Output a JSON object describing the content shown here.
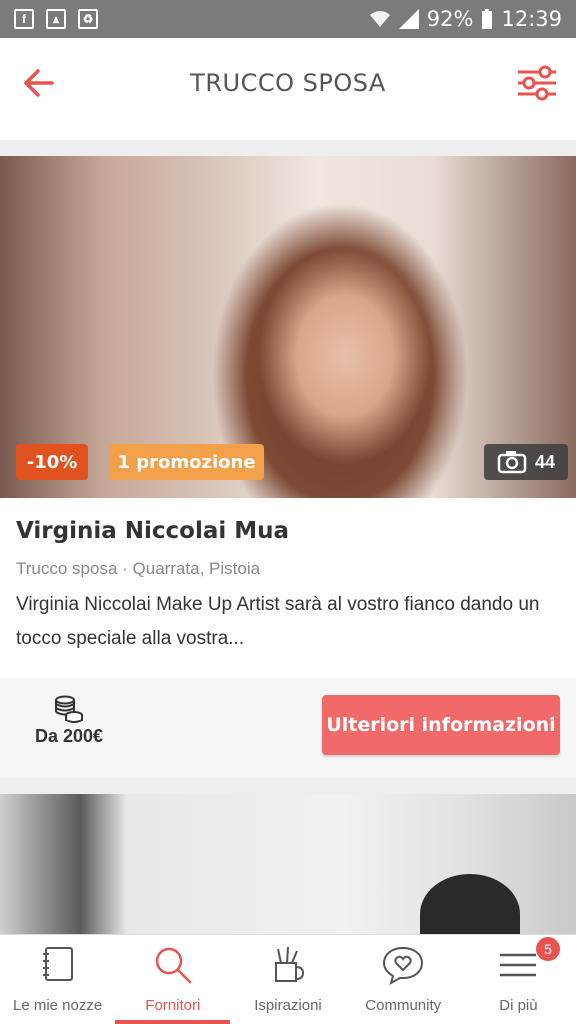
{
  "status_bar": {
    "battery": "92%",
    "time": "12:39"
  },
  "app_bar": {
    "title": "TRUCCO SPOSA"
  },
  "vendor": {
    "badge_discount": "-10%",
    "badge_promo": "1 promozione",
    "photo_count": "44",
    "name": "Virginia Niccolai Mua",
    "meta": "Trucco sposa · Quarrata, Pistoia",
    "description": "Virginia Niccolai Make Up Artist sarà al vostro fianco dando un tocco speciale alla vostra...",
    "price": "Da 200€",
    "cta": "Ulteriori informazioni"
  },
  "colors": {
    "accent": "#e8534f",
    "cta": "#f06a6a",
    "discount": "#e0531f",
    "promo": "#f2a04a"
  },
  "bottom_nav": {
    "items": [
      {
        "label": "Le mie nozze",
        "icon": "notebook-icon"
      },
      {
        "label": "Fornitori",
        "icon": "search-icon",
        "active": true
      },
      {
        "label": "Ispirazioni",
        "icon": "pencil-cup-icon"
      },
      {
        "label": "Community",
        "icon": "chat-heart-icon"
      },
      {
        "label": "Di più",
        "icon": "menu-icon",
        "badge": "5"
      }
    ]
  }
}
